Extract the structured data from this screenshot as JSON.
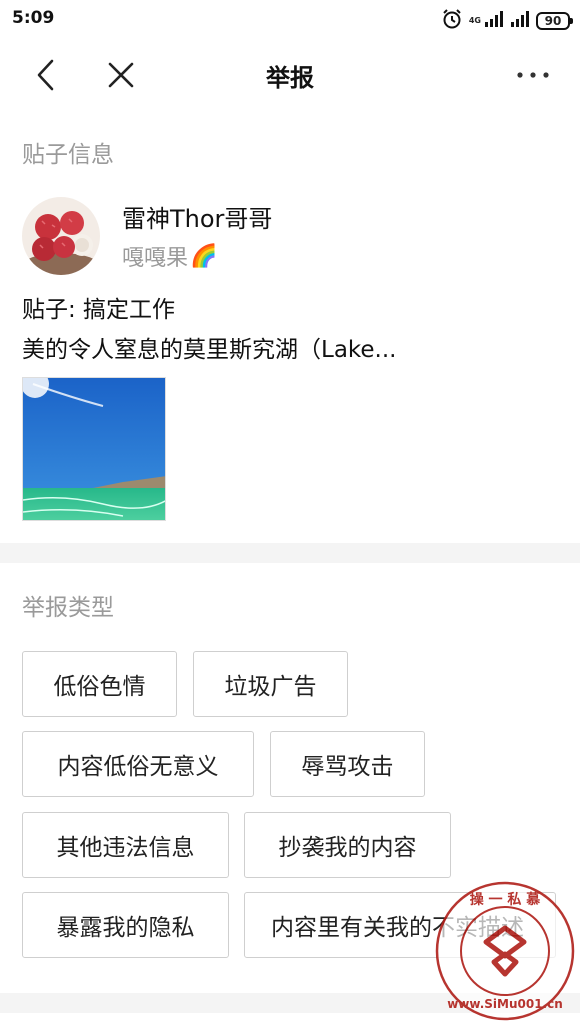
{
  "status_bar": {
    "time": "5:09",
    "network": "4G",
    "battery": "90",
    "icons": [
      "alarm-icon",
      "signal-icon",
      "signal-icon",
      "battery-icon"
    ]
  },
  "nav": {
    "title": "举报",
    "back_icon": "back-chevron-icon",
    "close_icon": "close-icon",
    "more_icon": "more-dots-icon"
  },
  "post_info": {
    "section_title": "贴子信息",
    "author_name": "雷神Thor哥哥",
    "author_subtitle": "嘎嘎果",
    "author_emoji": "🌈",
    "post_title": "贴子: 搞定工作",
    "post_excerpt": "美的令人窒息的莫里斯究湖（Lake..."
  },
  "report_types": {
    "section_title": "举报类型",
    "options": [
      "低俗色情",
      "垃圾广告",
      "内容低俗无意义",
      "辱骂攻击",
      "其他违法信息",
      "抄袭我的内容",
      "暴露我的隐私",
      "内容里有关我的不实描述"
    ]
  },
  "watermark": {
    "text": "www.SiMu001.cn",
    "chars": "操一私慕"
  },
  "colors": {
    "section_title": "#9a9a9a",
    "divider": "#f4f4f4",
    "tag_border": "#cfcfcf",
    "watermark": "#b0201a"
  }
}
